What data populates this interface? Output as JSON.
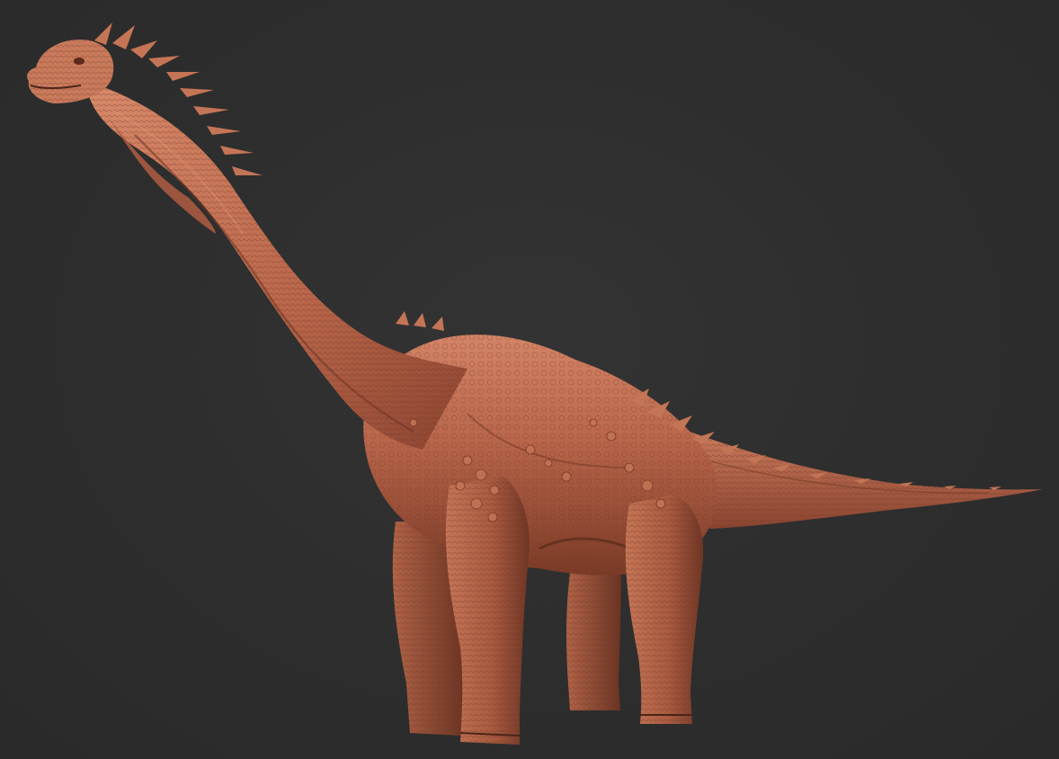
{
  "scene": {
    "subject": "sculpted-dinosaur",
    "background_color": "#2e2e2e",
    "material": {
      "base": "#b8654a",
      "light": "#d98a6a",
      "mid": "#a85a40",
      "shadow": "#6e3524",
      "deep": "#4a2418"
    }
  }
}
